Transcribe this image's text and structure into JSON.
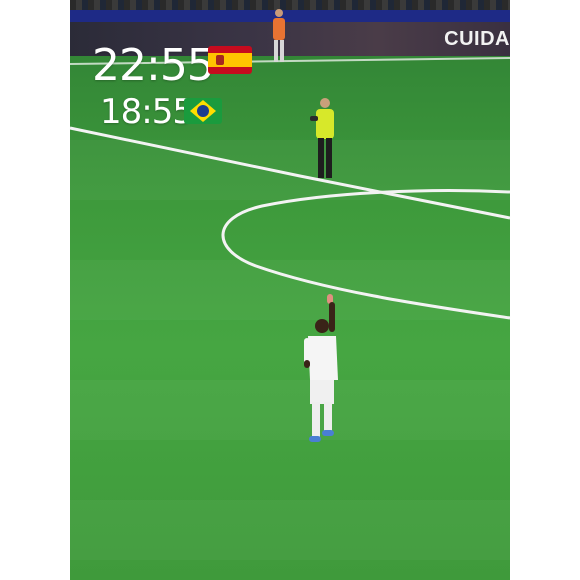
{
  "overlay": {
    "spain_time": "22:55",
    "brazil_time": "18:55"
  },
  "advert": {
    "text": "CUIDA"
  },
  "colors": {
    "pitch": "#3e9a3c",
    "pitch_lines": "#f3f3f3",
    "stand_band": "#1e2a86",
    "steward_vest": "#d7e82a",
    "player_kit": "#f5f5f5"
  },
  "icons": [
    "spain-flag-icon",
    "brazil-flag-icon"
  ]
}
